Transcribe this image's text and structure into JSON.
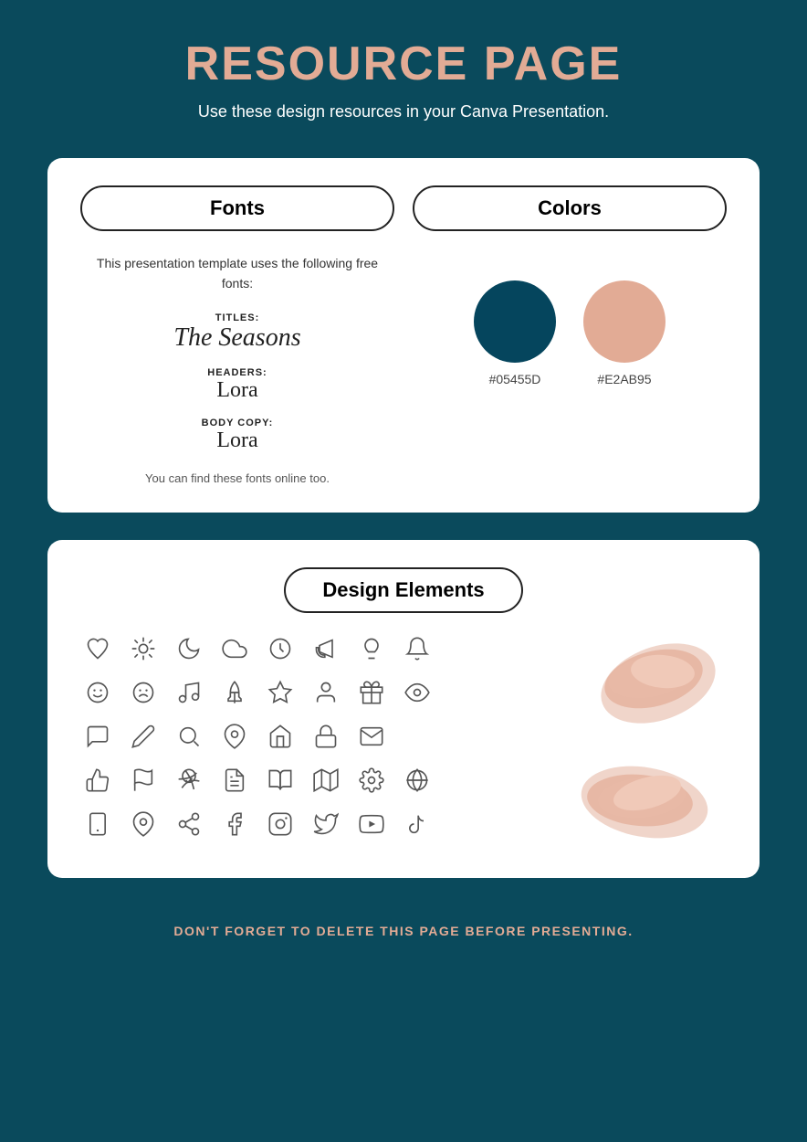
{
  "header": {
    "title": "RESOURCE PAGE",
    "subtitle": "Use these design resources in your Canva Presentation."
  },
  "fonts_card": {
    "fonts_label": "Fonts",
    "colors_label": "Colors",
    "intro": "This presentation template uses the following free fonts:",
    "titles_label": "TITLES:",
    "titles_font": "The Seasons",
    "headers_label": "HEADERS:",
    "headers_font": "Lora",
    "body_label": "BODY COPY:",
    "body_font": "Lora",
    "footer": "You can find these fonts online too.",
    "color1_hex": "#05455D",
    "color2_hex": "#E2AB95"
  },
  "design_elements": {
    "label": "Design Elements"
  },
  "footer": {
    "text": "DON'T FORGET TO DELETE THIS PAGE BEFORE PRESENTING."
  }
}
